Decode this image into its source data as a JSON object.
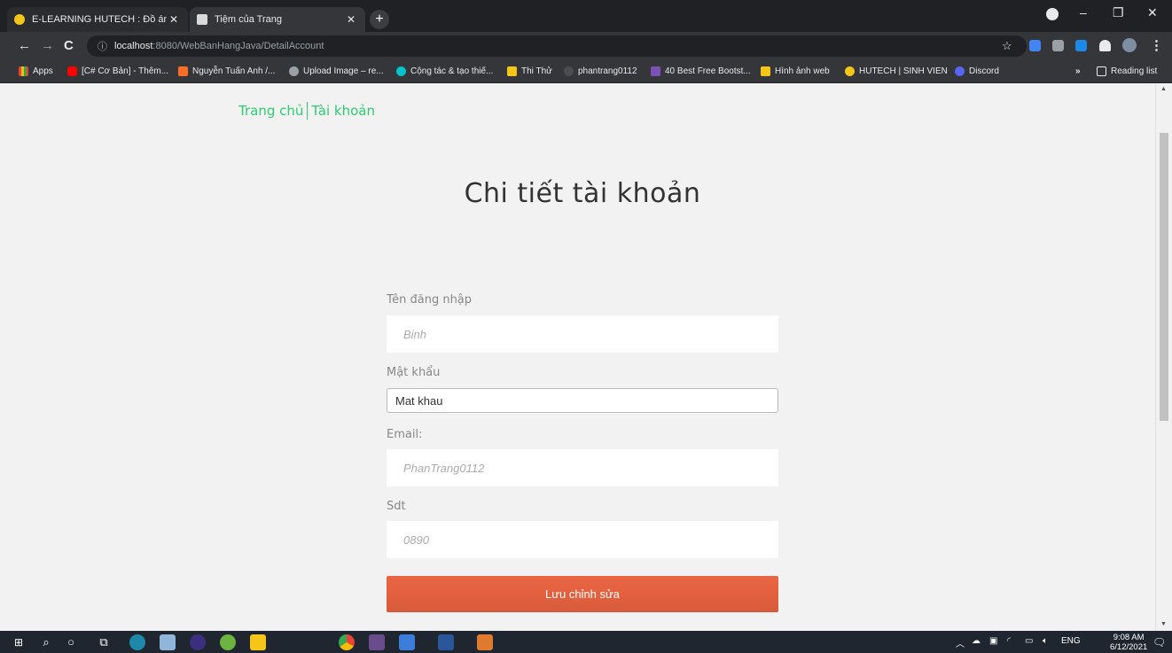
{
  "browser": {
    "tabs": [
      {
        "title": "E-LEARNING HUTECH : Đồ án jav",
        "active": false
      },
      {
        "title": "Tiệm của Trang",
        "active": true
      }
    ],
    "new_tab": "+",
    "url_host": "localhost",
    "url_rest": ":8080/WebBanHangJava/DetailAccount",
    "bookmarks": [
      {
        "label": "Apps",
        "icon": "apps-grid-icon"
      },
      {
        "label": "[C# Cơ Bản] - Thêm...",
        "icon": "youtube-icon"
      },
      {
        "label": "Nguyễn Tuấn Anh /...",
        "icon": "gitlab-icon"
      },
      {
        "label": "Upload Image – re...",
        "icon": "upload-icon"
      },
      {
        "label": "Cộng tác & tạo thiế...",
        "icon": "canva-icon"
      },
      {
        "label": "Thi Thử",
        "icon": "exam-icon"
      },
      {
        "label": "phantrang0112",
        "icon": "github-icon"
      },
      {
        "label": "40 Best Free Bootst...",
        "icon": "bootstrap-icon"
      },
      {
        "label": "Hình ảnh web",
        "icon": "folder-icon"
      },
      {
        "label": "HUTECH | SINH VIEN",
        "icon": "hutech-icon"
      },
      {
        "label": "Discord",
        "icon": "discord-icon"
      }
    ],
    "more_bookmarks": "»",
    "reading_list": "Reading list"
  },
  "page": {
    "nav": {
      "home": "Trang chủ",
      "account": "Tài khoản"
    },
    "title": "Chi tiết tài khoản",
    "form": {
      "username_label": "Tên đăng nhập",
      "username_placeholder": "Binh",
      "password_label": "Mật khẩu",
      "password_placeholder": "Mat khau",
      "email_label": "Email:",
      "email_placeholder": "PhanTrang0112",
      "phone_label": "Sdt",
      "phone_placeholder": "0890",
      "submit_label": "Lưu chỉnh sửa"
    }
  },
  "taskbar": {
    "lang": "ENG",
    "time": "9:08 AM",
    "date": "6/12/2021"
  },
  "colors": {
    "accent_green": "#2ecc71",
    "button_orange": "#e4603e"
  }
}
